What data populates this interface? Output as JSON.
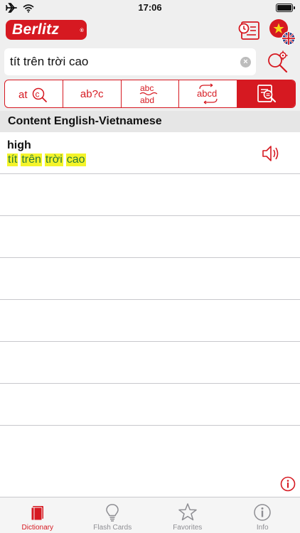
{
  "status_bar": {
    "time": "17:06"
  },
  "header": {
    "logo_text": "Berlitz",
    "logo_mark": "®"
  },
  "search": {
    "value": "tít trên trời cao",
    "clear_symbol": "×"
  },
  "modes": [
    {
      "icon": "spell-check-icon",
      "active": false
    },
    {
      "icon": "wildcard-search-icon",
      "label": "ab?c",
      "active": false
    },
    {
      "icon": "fuzzy-search-icon",
      "active": false
    },
    {
      "icon": "anagram-icon",
      "active": false
    },
    {
      "icon": "content-search-icon",
      "active": true
    }
  ],
  "section": {
    "title": "Content English-Vietnamese"
  },
  "results": [
    {
      "headword": "high",
      "translation_words": [
        "tít",
        "trên",
        "trời",
        "cao"
      ]
    }
  ],
  "tabbar": {
    "tabs": [
      {
        "label": "Dictionary",
        "icon": "book-icon",
        "active": true
      },
      {
        "label": "Flash Cards",
        "icon": "lightbulb-icon",
        "active": false
      },
      {
        "label": "Favorites",
        "icon": "star-icon",
        "active": false
      },
      {
        "label": "Info",
        "icon": "info-icon",
        "active": false
      }
    ]
  },
  "colors": {
    "accent": "#d61921",
    "highlight": "#f4f42a",
    "translation_text": "#2a7a3a",
    "bar_bg": "#efefef",
    "section_bg": "#e6e6e6"
  }
}
